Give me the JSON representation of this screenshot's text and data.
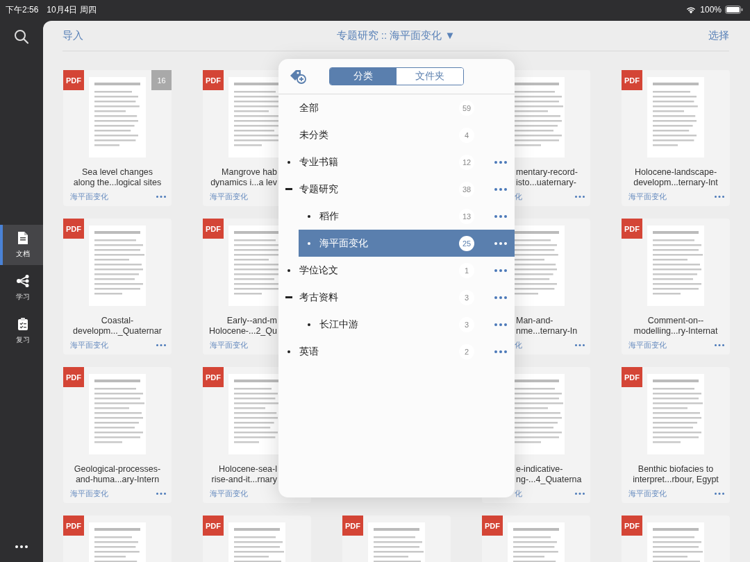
{
  "status_bar": {
    "time": "下午2:56",
    "date": "10月4日 周四",
    "battery": "100%"
  },
  "sidebar": {
    "items": [
      {
        "label": "文档",
        "kind": "doc",
        "selected": true
      },
      {
        "label": "学习",
        "kind": "learn",
        "selected": false
      },
      {
        "label": "复习",
        "kind": "review",
        "selected": false
      }
    ]
  },
  "header": {
    "import": "导入",
    "title": "专题研究 :: 海平面变化 ▼",
    "select": "选择"
  },
  "grid": {
    "rows": [
      {
        "cards": [
          {
            "badge": "PDF",
            "count": "16",
            "title": [
              "Sea level changes",
              "along the...logical sites"
            ],
            "tag": "海平面变化"
          },
          {
            "badge": "PDF",
            "title": [
              "Mangrove hab",
              "dynamics i...a lev"
            ],
            "tag": "海平面变化"
          },
          {
            "title": [
              "mentary-record-",
              "isto...uaternary-"
            ],
            "tag": "化"
          },
          {
            "badge": "PDF",
            "title": [
              "Holocene-landscape-",
              "developm...ternary-Int"
            ],
            "tag": "海平面变化"
          }
        ]
      },
      {
        "cards": [
          {
            "badge": "PDF",
            "title": [
              "Coastal-",
              "developm..._Quaternar"
            ],
            "tag": "海平面变化"
          },
          {
            "badge": "PDF",
            "title": [
              "Early--and-m",
              "Holocene-...2_Qu"
            ],
            "tag": "海平面变化"
          },
          {
            "title": [
              "Man-and-",
              "nme...ternary-In"
            ],
            "tag": "化"
          },
          {
            "badge": "PDF",
            "title": [
              "Comment-on--",
              "modelling...ry-Internat"
            ],
            "tag": "海平面变化"
          }
        ]
      },
      {
        "cards": [
          {
            "badge": "PDF",
            "title": [
              "Geological-processes-",
              "and-huma...ary-Intern"
            ],
            "tag": "海平面变化"
          },
          {
            "badge": "PDF",
            "title": [
              "Holocene-sea-l",
              "rise-and-it...rnary"
            ],
            "tag": "海平面变化"
          },
          {
            "title": [
              "e-indicative-",
              "ng-...4_Quaterna"
            ],
            "tag": "化"
          },
          {
            "badge": "PDF",
            "title": [
              "Benthic biofacies to",
              "interpret...rbour, Egypt"
            ],
            "tag": "海平面变化"
          }
        ]
      },
      {
        "cards": [
          {
            "badge": "PDF"
          },
          {
            "badge": "PDF"
          },
          {
            "badge": "PDF"
          },
          {
            "badge": "PDF"
          },
          {
            "badge": "PDF"
          }
        ]
      }
    ]
  },
  "popover": {
    "tabs": [
      {
        "label": "分类",
        "selected": true
      },
      {
        "label": "文件夹",
        "selected": false
      }
    ],
    "items": [
      {
        "kind": "fixed",
        "label": "全部",
        "count": "59",
        "selected": false
      },
      {
        "kind": "fixed",
        "label": "未分类",
        "count": "4",
        "selected": false
      },
      {
        "kind": "tag",
        "label": "专业书籍",
        "count": "12",
        "expanded": false,
        "selected": false
      },
      {
        "kind": "tag",
        "label": "专题研究",
        "count": "38",
        "expanded": true,
        "selected": false,
        "children": [
          {
            "kind": "tag",
            "label": "稻作",
            "count": "13",
            "expanded": false,
            "selected": false
          },
          {
            "kind": "tag",
            "label": "海平面变化",
            "count": "25",
            "expanded": false,
            "selected": true
          }
        ]
      },
      {
        "kind": "tag",
        "label": "学位论文",
        "count": "1",
        "expanded": false,
        "selected": false
      },
      {
        "kind": "tag",
        "label": "考古资料",
        "count": "3",
        "expanded": true,
        "selected": false,
        "children": [
          {
            "kind": "tag",
            "label": "长江中游",
            "count": "3",
            "expanded": false,
            "selected": false
          }
        ]
      },
      {
        "kind": "tag",
        "label": "英语",
        "count": "2",
        "expanded": false,
        "selected": false
      }
    ]
  }
}
